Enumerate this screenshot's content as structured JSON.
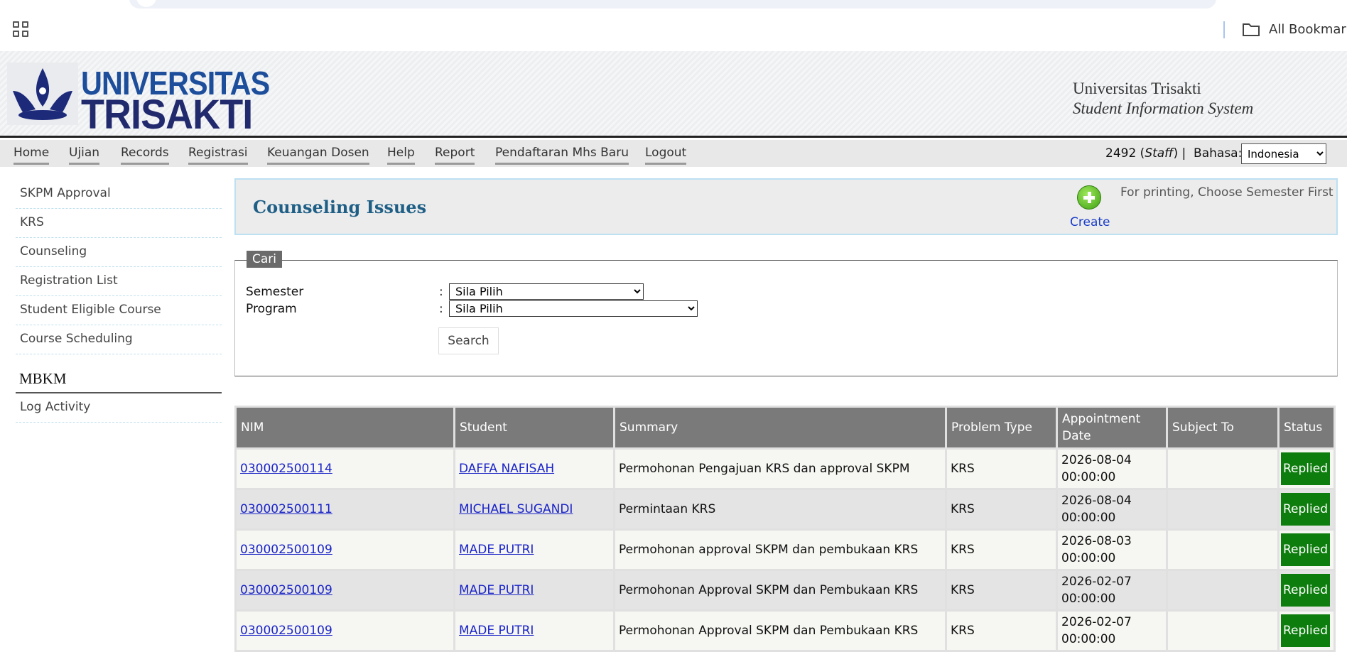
{
  "browser": {
    "bookmarks_label": "All Bookmarks",
    "apps_icon": "apps-grid-icon",
    "folder_icon": "folder-icon"
  },
  "header": {
    "logo_line1": "UNIVERSITAS",
    "logo_line2": "TRISAKTI",
    "site_name": "Universitas Trisakti",
    "site_subtitle": "Student Information System"
  },
  "nav": {
    "items": [
      "Home",
      "Ujian",
      "Records",
      "Registrasi",
      "Keuangan Dosen",
      "Help",
      "Report",
      "Pendaftaran Mhs Baru",
      "Logout"
    ],
    "user_id": "2492",
    "user_role": "Staff",
    "language_label": "Bahasa:",
    "language_value": "Indonesia"
  },
  "sidebar": {
    "items": [
      "SKPM Approval",
      "KRS",
      "Counseling",
      "Registration List",
      "Student Eligible Course",
      "Course Scheduling"
    ],
    "section_title": "MBKM",
    "section_items": [
      "Log Activity"
    ]
  },
  "main": {
    "title": "Counseling Issues",
    "create_label": "Create",
    "print_note": "For printing, Choose Semester First",
    "search": {
      "legend": "Cari",
      "semester_label": "Semester",
      "semester_value": "Sila Pilih",
      "program_label": "Program",
      "program_value": "Sila Pilih",
      "colon": ":",
      "button_label": "Search"
    },
    "table": {
      "headers": [
        "NIM",
        "Student",
        "Summary",
        "Problem Type",
        "Appointment Date",
        "Subject To",
        "Status"
      ],
      "rows": [
        {
          "nim": "030002500114",
          "student": "DAFFA NAFISAH",
          "summary": "Permohonan Pengajuan KRS dan approval SKPM",
          "problem_type": "KRS",
          "date": "2026-08-04",
          "time": "00:00:00",
          "subject_to": "",
          "status": "Replied"
        },
        {
          "nim": "030002500111",
          "student": "MICHAEL SUGANDI",
          "summary": "Permintaan KRS",
          "problem_type": "KRS",
          "date": "2026-08-04",
          "time": "00:00:00",
          "subject_to": "",
          "status": "Replied"
        },
        {
          "nim": "030002500109",
          "student": "MADE PUTRI",
          "summary": "Permohonan approval SKPM dan pembukaan KRS",
          "problem_type": "KRS",
          "date": "2026-08-03",
          "time": "00:00:00",
          "subject_to": "",
          "status": "Replied"
        },
        {
          "nim": "030002500109",
          "student": "MADE PUTRI",
          "summary": "Permohonan Approval SKPM dan Pembukaan KRS",
          "problem_type": "KRS",
          "date": "2026-02-07",
          "time": "00:00:00",
          "subject_to": "",
          "status": "Replied"
        },
        {
          "nim": "030002500109",
          "student": "MADE PUTRI",
          "summary": "Permohonan Approval SKPM dan Pembukaan KRS",
          "problem_type": "KRS",
          "date": "2026-02-07",
          "time": "00:00:00",
          "subject_to": "",
          "status": "Replied"
        }
      ]
    }
  },
  "colors": {
    "nav_bg": "#e8e8e8",
    "table_header_bg": "#7a7a7a",
    "status_replied": "#0d7d0d",
    "title_color": "#1f5f86",
    "link_color": "#1a24c8"
  }
}
